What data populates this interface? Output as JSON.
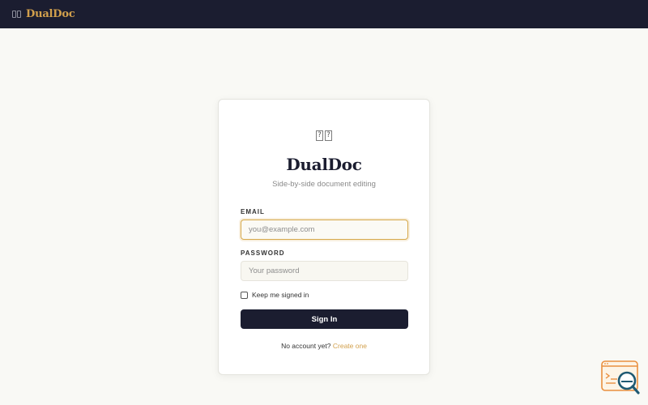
{
  "topbar": {
    "brand": "DualDoc"
  },
  "card": {
    "icon_glyphs": [
      "?",
      "?"
    ],
    "title": "DualDoc",
    "subtitle": "Side-by-side document editing",
    "email": {
      "label": "EMAIL",
      "placeholder": "you@example.com",
      "value": ""
    },
    "password": {
      "label": "PASSWORD",
      "placeholder": "Your password",
      "value": ""
    },
    "remember": {
      "label": "Keep me signed in",
      "checked": false
    },
    "signin_label": "Sign In",
    "footer": {
      "prompt": "No account yet?",
      "link": "Create one"
    }
  },
  "colors": {
    "topbar_bg": "#1b1d30",
    "brand_accent": "#d2a04c",
    "page_bg": "#f9f9f5",
    "focus_border": "#d6a849"
  },
  "icons": {
    "topbar_logo": "book-open-icon",
    "card_logo": "dual-document-icon",
    "corner_widget": "search-code-icon"
  }
}
